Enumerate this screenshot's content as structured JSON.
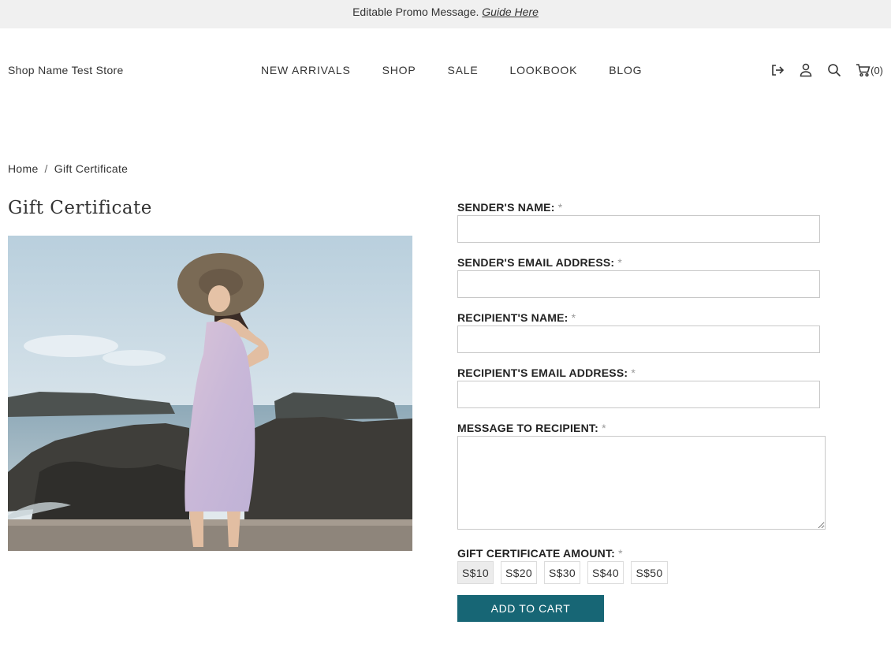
{
  "promo": {
    "text": "Editable Promo Message.",
    "link": "Guide Here"
  },
  "header": {
    "store_name": "Shop Name Test Store",
    "nav": [
      "NEW ARRIVALS",
      "SHOP",
      "SALE",
      "LOOKBOOK",
      "BLOG"
    ],
    "icons": [
      "logout-icon",
      "user-icon",
      "search-icon",
      "cart-icon"
    ],
    "cart_count": "(0)"
  },
  "breadcrumb": {
    "home": "Home",
    "separator": "/",
    "current": "Gift Certificate"
  },
  "page": {
    "title": "Gift Certificate"
  },
  "form": {
    "required_mark": "*",
    "sender_name": {
      "label": "SENDER'S NAME:",
      "value": ""
    },
    "sender_email": {
      "label": "SENDER'S EMAIL ADDRESS:",
      "value": ""
    },
    "recipient_name": {
      "label": "RECIPIENT'S NAME:",
      "value": ""
    },
    "recipient_email": {
      "label": "RECIPIENT'S EMAIL ADDRESS:",
      "value": ""
    },
    "message": {
      "label": "MESSAGE TO RECIPIENT:",
      "value": ""
    },
    "amount": {
      "label": "GIFT CERTIFICATE AMOUNT:",
      "options": [
        "S$10",
        "S$20",
        "S$30",
        "S$40",
        "S$50"
      ],
      "selected": "S$10"
    },
    "submit_label": "ADD TO CART"
  },
  "colors": {
    "accent": "#176675",
    "promo_bg": "#f0f0f0"
  }
}
